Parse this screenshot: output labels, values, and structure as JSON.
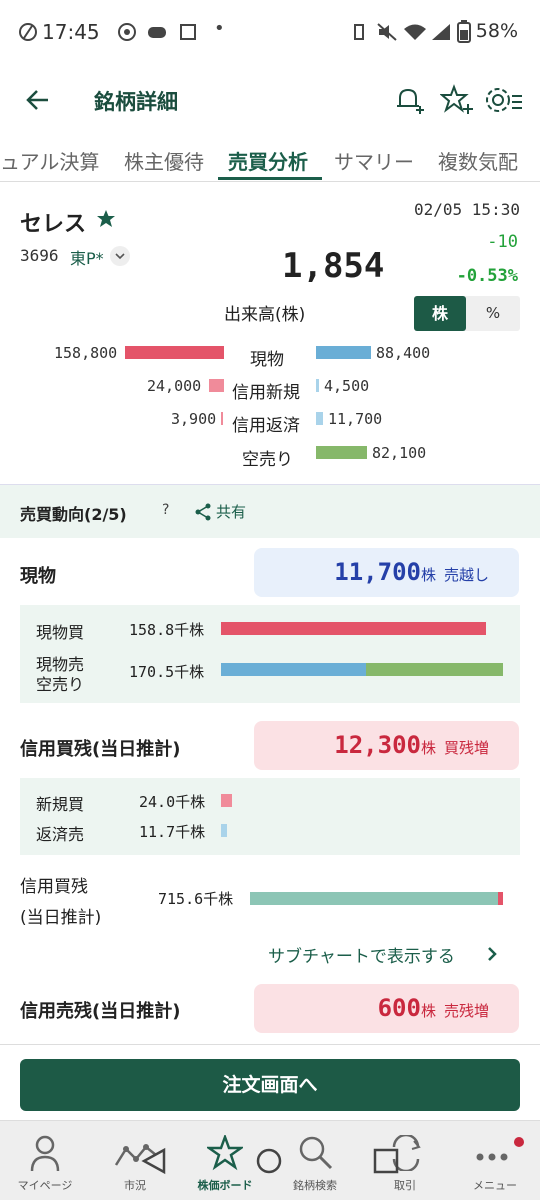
{
  "status": {
    "time": "17:45",
    "battery": "58%"
  },
  "header": {
    "title": "銘柄詳細"
  },
  "tabs": [
    "ュアル決算",
    "株主優待",
    "売買分析",
    "サマリー",
    "複数気配"
  ],
  "stock": {
    "name": "セレス",
    "code": "3696",
    "market": "東P*",
    "datetime": "02/05 15:30",
    "price": "1,854",
    "change": "-10",
    "change_pct": "-0.53%"
  },
  "volume": {
    "label": "出来高(株)",
    "toggle": [
      "株",
      "%"
    ],
    "rows": [
      {
        "label": "現物",
        "left": "158,800",
        "right": "88,400"
      },
      {
        "label": "信用新規",
        "left": "24,000",
        "right": "4,500"
      },
      {
        "label": "信用返済",
        "left": "3,900",
        "right": "11,700"
      },
      {
        "label": "空売り",
        "left": "",
        "right": "82,100"
      }
    ]
  },
  "trend": {
    "title": "売買動向(2/5)",
    "help": "?",
    "share": "共有"
  },
  "genbutsu": {
    "title": "現物",
    "value": "11,700",
    "unit": "株",
    "status": "売越し",
    "buy_label": "現物買",
    "buy_value": "158.8千株",
    "sell_label1": "現物売",
    "sell_label2": "空売り",
    "sell_value": "170.5千株"
  },
  "margin_buy": {
    "title": "信用買残(当日推計)",
    "value": "12,300",
    "unit": "株",
    "status": "買残増",
    "new_label": "新規買",
    "new_value": "24.0千株",
    "repay_label": "返済売",
    "repay_value": "11.7千株",
    "balance_label1": "信用買残",
    "balance_label2": "(当日推計)",
    "balance_value": "715.6千株",
    "subchart_link": "サブチャートで表示する"
  },
  "margin_sell": {
    "title": "信用売残(当日推計)",
    "value": "600",
    "unit": "株",
    "status": "売残増"
  },
  "order_button": "注文画面へ",
  "nav": [
    "マイページ",
    "市況",
    "株価ボード",
    "銘柄検索",
    "取引",
    "メニュー"
  ],
  "colors": {
    "accent": "#1d5a46",
    "up": "#23a23a",
    "sell_pill": "#e8f0fb",
    "buy_pill": "#fbe1e4"
  }
}
